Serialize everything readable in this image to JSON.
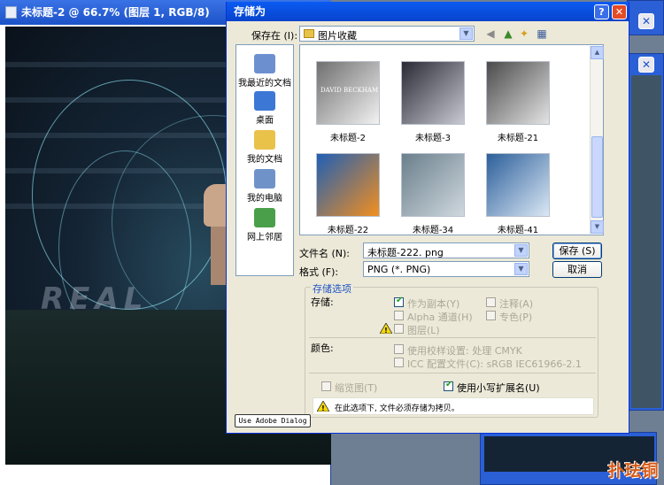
{
  "background_window": {
    "title": "未标题-2 @ 66.7% (图层 1, RGB/8)",
    "canvas_watermark": "REAL"
  },
  "side_windows": {
    "close_glyph": "✕"
  },
  "dialog": {
    "title": "存储为",
    "help_glyph": "?",
    "close_glyph": "✕",
    "save_in": {
      "label": "保存在 (I):",
      "value": "图片收藏"
    },
    "places": [
      {
        "label": "我最近的文档",
        "icon": "recent-docs-icon",
        "color": "#6c8fd0"
      },
      {
        "label": "桌面",
        "icon": "desktop-icon",
        "color": "#3d77d6"
      },
      {
        "label": "我的文档",
        "icon": "my-documents-icon",
        "color": "#e9c24a"
      },
      {
        "label": "我的电脑",
        "icon": "my-computer-icon",
        "color": "#6f93c9"
      },
      {
        "label": "网上邻居",
        "icon": "network-icon",
        "color": "#4aa04a"
      }
    ],
    "files": [
      {
        "name": "未标题-2",
        "colors": [
          "#6f6f6f",
          "#f2f2f2"
        ],
        "overlay": "DAVID BECKHAM"
      },
      {
        "name": "未标题-3",
        "colors": [
          "#2a2a35",
          "#c9c9d4"
        ],
        "overlay": ""
      },
      {
        "name": "未标题-21",
        "colors": [
          "#4a4a4a",
          "#e4e4e4"
        ],
        "overlay": ""
      },
      {
        "name": "未标题-22",
        "colors": [
          "#1f5fb5",
          "#f28f1e"
        ],
        "overlay": ""
      },
      {
        "name": "未标题-34",
        "colors": [
          "#6a7f8c",
          "#cfd8de"
        ],
        "overlay": ""
      },
      {
        "name": "未标题-41",
        "colors": [
          "#2c5f9a",
          "#dbe8f5"
        ],
        "overlay": ""
      }
    ],
    "filename": {
      "label": "文件名 (N):",
      "value": "未标题-222. png"
    },
    "format": {
      "label": "格式 (F):",
      "value": "PNG (*. PNG)"
    },
    "save_label": "保存 (S)",
    "cancel_label": "取消",
    "options": {
      "group_label": "存储选项",
      "storage_label": "存储:",
      "as_copy": {
        "label": "作为副本(Y)",
        "checked": true
      },
      "annotations": {
        "label": "注释(A)",
        "checked": false
      },
      "alpha": {
        "label": "Alpha 通道(H)",
        "checked": false
      },
      "spot": {
        "label": "专色(P)",
        "checked": false
      },
      "layers": {
        "label": "图层(L)",
        "checked": false
      },
      "color_label": "颜色:",
      "proof": {
        "label": "使用校样设置: 处理 CMYK",
        "checked": false
      },
      "icc": {
        "label": "ICC 配置文件(C): sRGB IEC61966-2.1",
        "checked": false
      },
      "thumbnail": {
        "label": "缩览图(T)",
        "checked": false
      },
      "lowercase": {
        "label": "使用小写扩展名(U)",
        "checked": true
      },
      "warning": "在此选项下, 文件必须存储为拷贝。"
    },
    "adobe_dialog_label": "Use Adobe Dialog"
  },
  "logo": {
    "text": "扑珐铜"
  }
}
